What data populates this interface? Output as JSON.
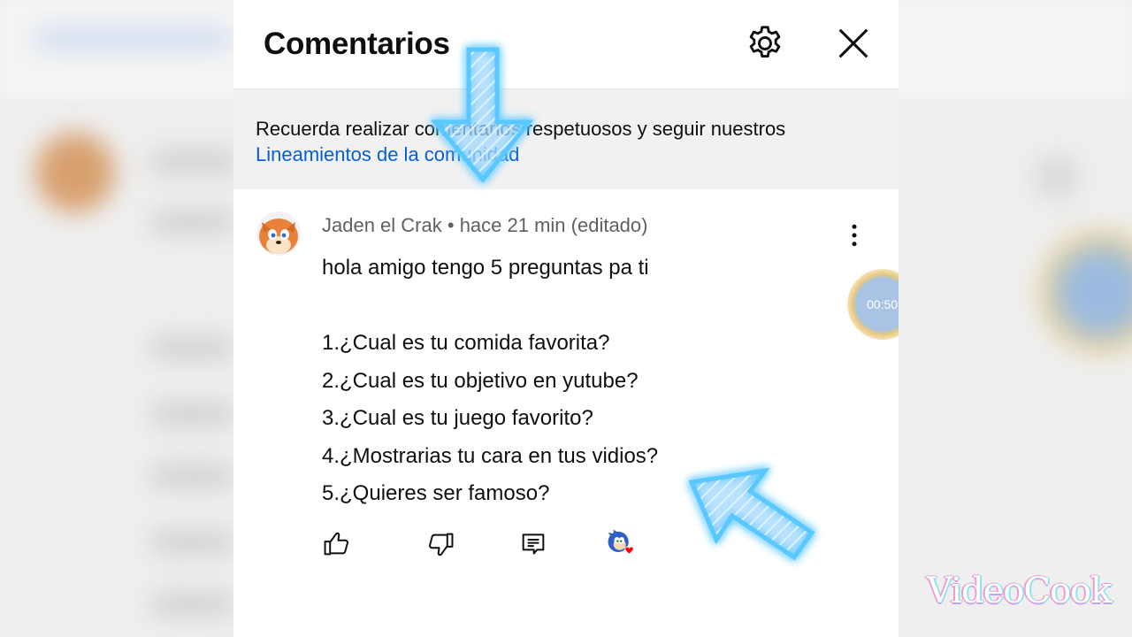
{
  "panel": {
    "title": "Comentarios",
    "notice": {
      "text": "Recuerda realizar comentarios respetuosos y seguir nuestros",
      "link": "Lineamientos de la comunidad"
    }
  },
  "comment": {
    "author": "Jaden el Crak",
    "separator": " • ",
    "time": "hace 21 min (editado)",
    "lines": [
      "hola amigo tengo 5 preguntas pa ti",
      "",
      "1.¿Cual es tu comida favorita?",
      "2.¿Cual es tu objetivo en yutube?",
      "3.¿Cual es tu juego favorito?",
      "4.¿Mostrarias tu cara en tus vidios?",
      "5.¿Quieres ser famoso?"
    ]
  },
  "icons": {
    "settings": "gear-icon",
    "close": "close-icon",
    "more": "more-vert-icon",
    "like": "thumb-up-icon",
    "dislike": "thumb-down-icon",
    "reply": "reply-icon",
    "creator_heart": "creator-heart-icon"
  },
  "timer": {
    "text": "00:50"
  },
  "watermark": {
    "text": "VideoCook"
  },
  "colors": {
    "link": "#065fd4",
    "meta": "#606060",
    "notice_bg": "#f1f1f1",
    "heart": "#ff0000",
    "arrow_glow": "#6fd0ff"
  }
}
